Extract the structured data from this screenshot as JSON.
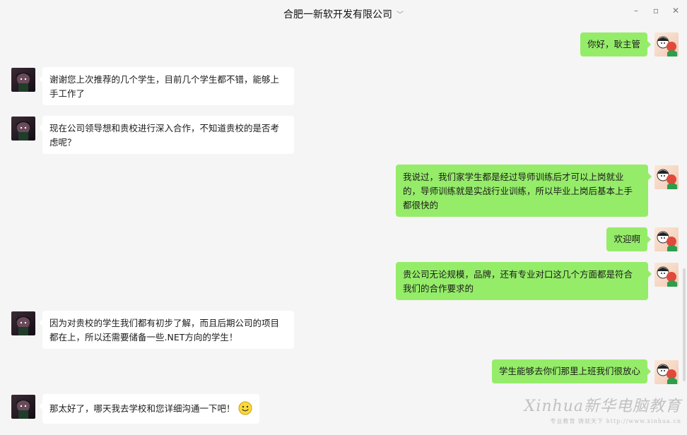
{
  "window": {
    "title": "合肥一新软开发有限公司",
    "controls": [
      "–",
      "▫",
      "✕"
    ]
  },
  "messages": [
    {
      "side": "right",
      "text": "你好，耿主管"
    },
    {
      "side": "left",
      "text": "谢谢您上次推荐的几个学生，目前几个学生都不错，能够上手工作了"
    },
    {
      "side": "left",
      "text": "现在公司领导想和贵校进行深入合作，不知道贵校的是否考虑呢？"
    },
    {
      "side": "right",
      "text": "我说过，我们家学生都是经过导师训练后才可以上岗就业的，导师训练就是实战行业训练，所以毕业上岗后基本上手都很快的"
    },
    {
      "side": "right",
      "text": "欢迎啊"
    },
    {
      "side": "right",
      "text": "贵公司无论规模，品牌，还有专业对口这几个方面都是符合我们的合作要求的"
    },
    {
      "side": "left",
      "text": "因为对贵校的学生我们都有初步了解，而且后期公司的项目都在上，所以还需要储备一些.NET方向的学生！"
    },
    {
      "side": "right",
      "text": "学生能够去你们那里上班我们很放心"
    },
    {
      "side": "left",
      "text": "那太好了，哪天我去学校和您详细沟通一下吧！",
      "emoji": "smile-emoji"
    }
  ],
  "watermark": {
    "brand": "Xinhua新华电脑教育",
    "slogan": "专业教育  铸就天下  http://www.xinhua.cn"
  },
  "colors": {
    "background": "#f5f5f5",
    "bubble_self": "#95ec69",
    "bubble_other": "#ffffff"
  }
}
